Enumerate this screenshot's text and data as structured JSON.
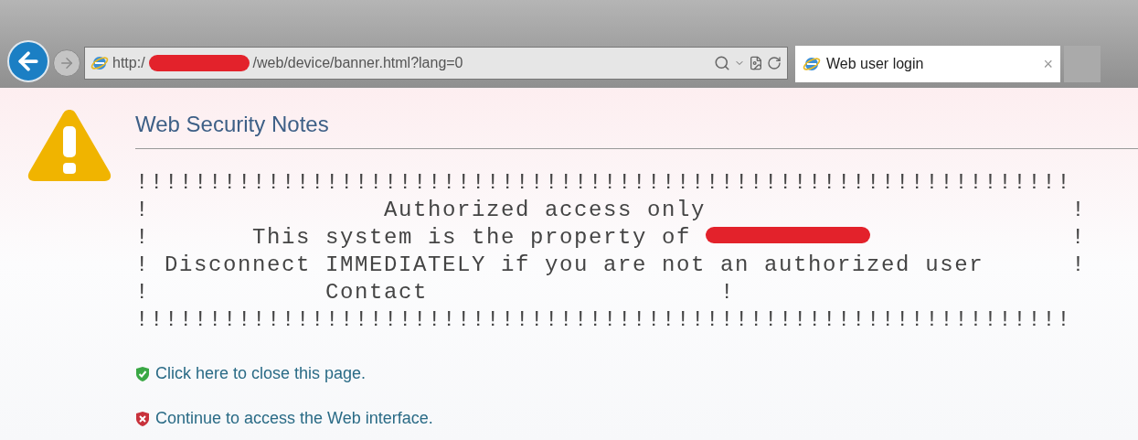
{
  "browser": {
    "url_start": "http:/",
    "url_redacted": true,
    "url_end": "/web/device/banner.html?lang=0",
    "tab": {
      "title": "Web user login",
      "close": "×"
    }
  },
  "page": {
    "title": "Web Security Notes",
    "banner": [
      {
        "text": "!!!!!!!!!!!!!!!!!!!!!!!!!!!!!!!!!!!!!!!!!!!!!!!!!!!!!!!!!!!!!!!!"
      },
      {
        "text": "!                Authorized access only                         !"
      },
      {
        "text": "!       This system is the property of",
        "redacted": true,
        "end": "!"
      },
      {
        "text": "! Disconnect IMMEDIATELY if you are not an authorized user      !"
      },
      {
        "text": "!            Contact                    !"
      },
      {
        "text": "!!!!!!!!!!!!!!!!!!!!!!!!!!!!!!!!!!!!!!!!!!!!!!!!!!!!!!!!!!!!!!!!"
      }
    ],
    "links": [
      {
        "kind": "safe",
        "text": "Click here to close this page."
      },
      {
        "kind": "unsafe",
        "text": "Continue to access the Web interface."
      }
    ]
  }
}
